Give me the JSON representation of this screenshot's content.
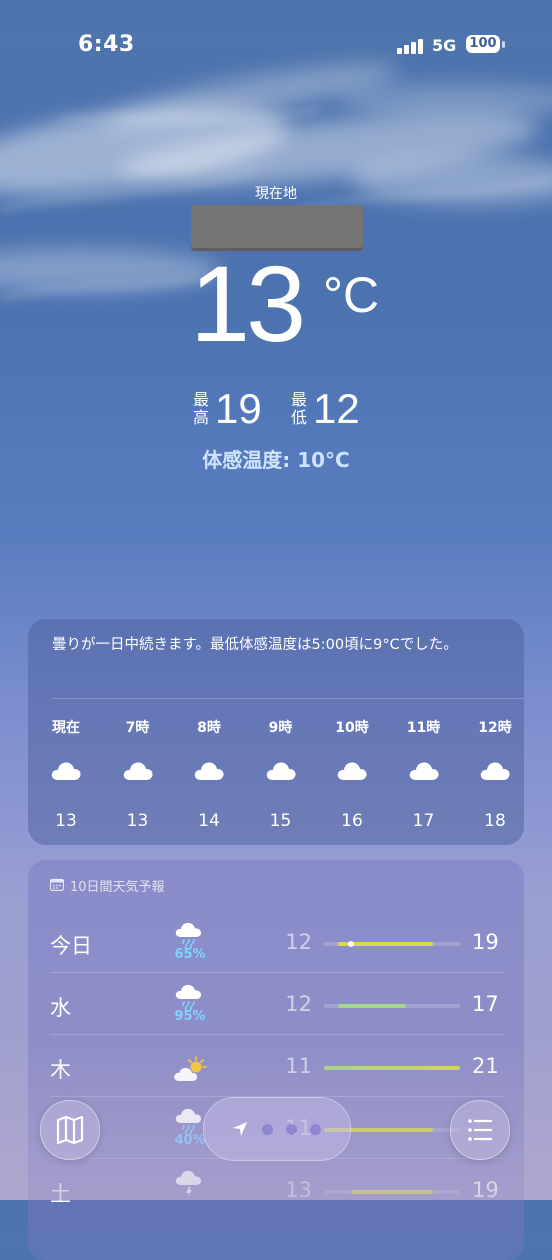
{
  "status_bar": {
    "time": "6:43",
    "network": "5G",
    "battery": "100"
  },
  "location": {
    "label": "現在地",
    "name_redacted": true
  },
  "current": {
    "temp": "13",
    "unit": "°C",
    "high_label": "最\n高",
    "high": "19",
    "low_label": "最\n低",
    "low": "12",
    "feels_like": "体感温度: 10°C"
  },
  "hourly": {
    "summary": "曇りが一日中続きます。最低体感温度は5:00頃に9°Cでした。",
    "items": [
      {
        "time": "現在",
        "icon": "cloud-icon",
        "temp": "13"
      },
      {
        "time": "7時",
        "icon": "cloud-icon",
        "temp": "13"
      },
      {
        "time": "8時",
        "icon": "cloud-icon",
        "temp": "14"
      },
      {
        "time": "9時",
        "icon": "cloud-icon",
        "temp": "15"
      },
      {
        "time": "10時",
        "icon": "cloud-icon",
        "temp": "16"
      },
      {
        "time": "11時",
        "icon": "cloud-icon",
        "temp": "17"
      },
      {
        "time": "12時",
        "icon": "cloud-icon",
        "temp": "18"
      }
    ]
  },
  "daily": {
    "title": "10日間天気予報",
    "title_icon": "calendar-icon",
    "range_min": 11,
    "range_max": 21,
    "days": [
      {
        "day": "今日",
        "icon": "rain-cloud-icon",
        "precip": "65%",
        "low": "12",
        "high": "19",
        "current": 13
      },
      {
        "day": "水",
        "icon": "rain-cloud-icon",
        "precip": "95%",
        "low": "12",
        "high": "17"
      },
      {
        "day": "木",
        "icon": "partly-sunny-icon",
        "precip": "",
        "low": "11",
        "high": "21"
      },
      {
        "day": "",
        "icon": "rain-cloud-icon",
        "precip": "40%",
        "low": "11",
        "high": ""
      },
      {
        "day": "土",
        "icon": "thunderstorm-icon",
        "precip": "",
        "low": "13",
        "high": "19"
      }
    ]
  },
  "colors": {
    "accent_precip": "#7fd3ff",
    "bar_warm": "#d9d94a",
    "bar_cool": "#a6d88a"
  }
}
